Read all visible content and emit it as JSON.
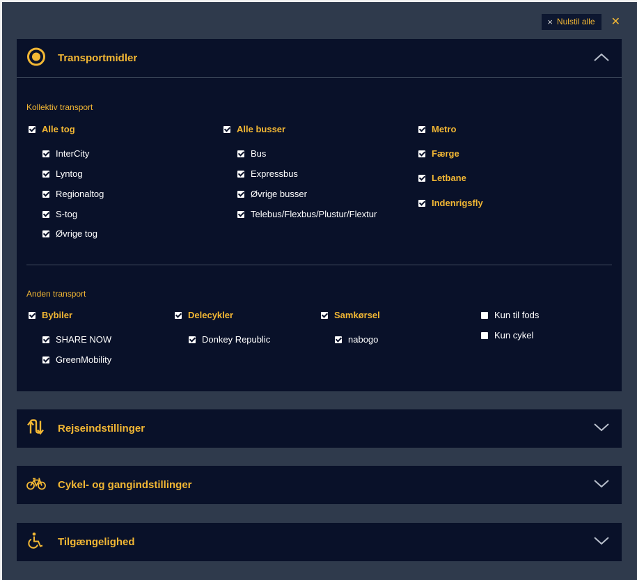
{
  "toolbar": {
    "reset_label": "Nulstil alle"
  },
  "panels": {
    "transport": {
      "title": "Transportmidler"
    },
    "rejse": {
      "title": "Rejseindstillinger"
    },
    "cykel": {
      "title": "Cykel- og gangindstillinger"
    },
    "tilg": {
      "title": "Tilgængelighed"
    }
  },
  "kollektiv": {
    "label": "Kollektiv transport",
    "tog": {
      "label": "Alle tog",
      "checked": true,
      "items": [
        {
          "label": "InterCity",
          "checked": true
        },
        {
          "label": "Lyntog",
          "checked": true
        },
        {
          "label": "Regionaltog",
          "checked": true
        },
        {
          "label": "S-tog",
          "checked": true
        },
        {
          "label": "Øvrige tog",
          "checked": true
        }
      ]
    },
    "busser": {
      "label": "Alle busser",
      "checked": true,
      "items": [
        {
          "label": "Bus",
          "checked": true
        },
        {
          "label": "Expressbus",
          "checked": true
        },
        {
          "label": "Øvrige busser",
          "checked": true
        },
        {
          "label": "Telebus/Flexbus/Plustur/Flextur",
          "checked": true
        }
      ]
    },
    "other": [
      {
        "label": "Metro",
        "checked": true
      },
      {
        "label": "Færge",
        "checked": true
      },
      {
        "label": "Letbane",
        "checked": true
      },
      {
        "label": "Indenrigsfly",
        "checked": true
      }
    ]
  },
  "anden": {
    "label": "Anden transport",
    "bybiler": {
      "label": "Bybiler",
      "checked": true,
      "items": [
        {
          "label": "SHARE NOW",
          "checked": true
        },
        {
          "label": "GreenMobility",
          "checked": true
        }
      ]
    },
    "delecykler": {
      "label": "Delecykler",
      "checked": true,
      "items": [
        {
          "label": "Donkey Republic",
          "checked": true
        }
      ]
    },
    "samkorsel": {
      "label": "Samkørsel",
      "checked": true,
      "items": [
        {
          "label": "nabogo",
          "checked": true
        }
      ]
    },
    "fods": {
      "label": "Kun til fods",
      "checked": false
    },
    "cykel": {
      "label": "Kun cykel",
      "checked": false
    }
  },
  "colors": {
    "accent": "#f2b734",
    "panel": "#091129",
    "background": "#2f3a4c"
  }
}
